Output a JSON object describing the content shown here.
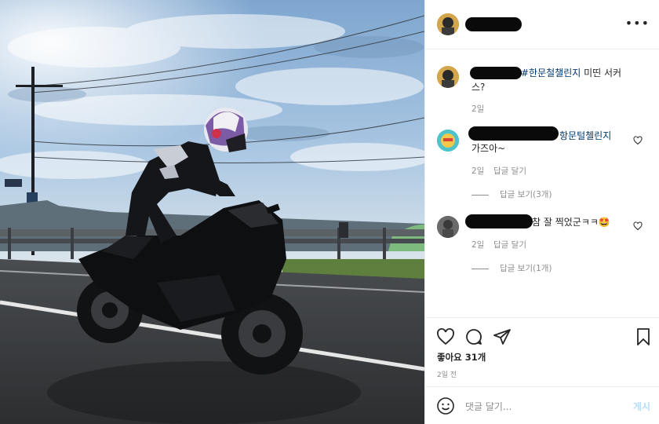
{
  "post": {
    "more_label": "•••",
    "caption": {
      "hashtag": "#한문철챌린지",
      "text_tail": " 미띤 서커",
      "text_line2": "스?",
      "time": "2일"
    },
    "comments": [
      {
        "tag": "항문털첼린지",
        "text": "가즈아~",
        "time": "2일",
        "reply_label": "답글 달기",
        "view_replies": "답글 보기(3개)"
      },
      {
        "text_tail": "참 잘 찍었군ㅋㅋ🤩",
        "time": "2일",
        "reply_label": "답글 달기",
        "view_replies": "답글 보기(1개)"
      }
    ],
    "likes": "좋아요 31개",
    "posted_ago": "2일 전",
    "comment_placeholder": "댓글 달기...",
    "post_button": "게시"
  },
  "icons": {
    "more": "more-options-icon",
    "like": "heart-icon",
    "comment": "comment-icon",
    "share": "share-icon",
    "save": "bookmark-icon",
    "emoji": "emoji-icon"
  },
  "colors": {
    "hashtag": "#00376b",
    "muted": "#8e8e8e",
    "post_button": "#b2dffc",
    "divider": "#efefef"
  }
}
